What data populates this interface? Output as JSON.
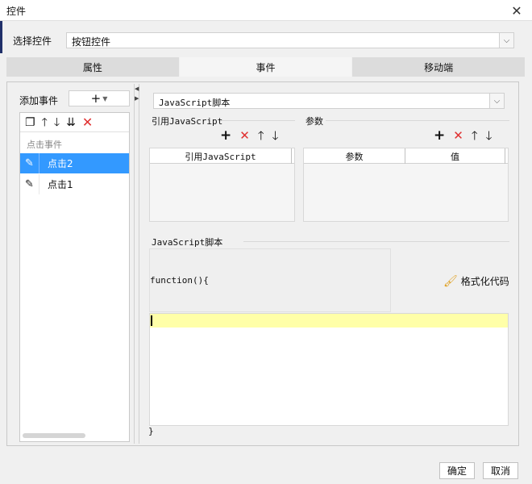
{
  "window": {
    "title": "控件",
    "close_glyph": "✕"
  },
  "control_selector": {
    "label": "选择控件",
    "value": "按钮控件"
  },
  "tabs": [
    {
      "label": "属性",
      "active": false
    },
    {
      "label": "事件",
      "active": true
    },
    {
      "label": "移动端",
      "active": false
    }
  ],
  "events_panel": {
    "add_label": "添加事件",
    "add_button_icon": "plus-icon",
    "toolbar_icons": [
      "copy-icon",
      "arrow-up-icon",
      "arrow-down-icon",
      "move-to-bottom-icon",
      "delete-icon"
    ],
    "category": "点击事件",
    "items": [
      {
        "label": "点击2",
        "icon": "pencil-icon",
        "selected": true
      },
      {
        "label": "点击1",
        "icon": "pencil-icon",
        "selected": false
      }
    ]
  },
  "type_select": {
    "value": "JavaScript脚本"
  },
  "reference_js": {
    "title": "引用JavaScript",
    "column": "引用JavaScript",
    "icons": [
      "add-icon",
      "delete-icon",
      "arrow-up-icon",
      "arrow-down-icon"
    ]
  },
  "params": {
    "title": "参数",
    "columns": [
      "参数",
      "值"
    ],
    "icons": [
      "add-icon",
      "delete-icon",
      "arrow-up-icon",
      "arrow-down-icon"
    ]
  },
  "script": {
    "title": "JavaScript脚本",
    "function_open": "function(){",
    "function_close": "}",
    "format_button": "格式化代码"
  },
  "footer": {
    "ok": "确定",
    "cancel": "取消"
  },
  "colors": {
    "selection": "#3399ff",
    "delete_red": "#e03030",
    "editor_highlight": "#ffffa8",
    "accent_left": "#20306a"
  }
}
